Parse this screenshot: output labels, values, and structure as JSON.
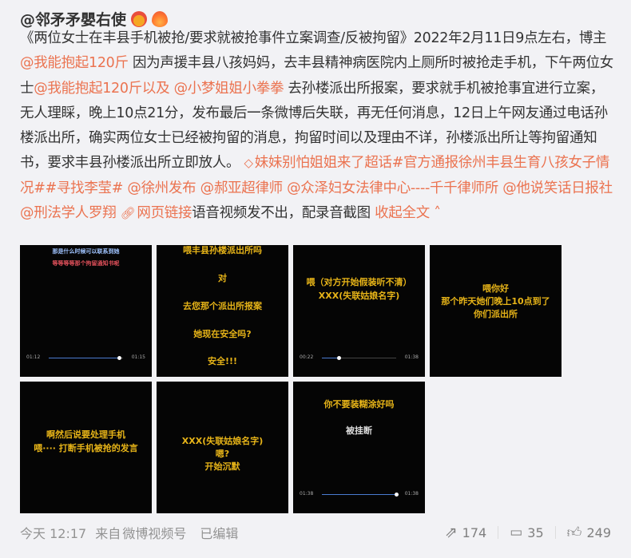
{
  "post": {
    "author": "@邻矛矛嬰右使",
    "body": {
      "t1": "《两位女士在丰县手机被抢/要求就被抢事件立案调查/反被拘留》2022年2月11日9点左右，博主",
      "m1": "@我能抱起120斤",
      "t2": " 因为声援丰县八孩妈妈，去丰县精神病医院内上厕所时被抢走手机，下午两位女士",
      "m2": "@我能抱起120斤以及",
      "t3": " ",
      "m3": "@小梦姐姐小拳拳",
      "t4": " 去孙楼派出所报案，要求就手机被抢事宜进行立案，无人理睬，晚上10点21分，发布最后一条微博后失联，再无任何消息，12日上午网友通过电话孙楼派出所，确实两位女士已经被拘留的消息，拘留时间以及理由不详，孙楼派出所让等拘留通知书，要求丰县孙楼派出所立即放人。",
      "supertopic": "妹妹别怕姐姐来了超话",
      "topic1": "#官方通报徐州丰县生育八孩女子情况#",
      "topic2": "#寻找李莹#",
      "m4": "@徐州发布",
      "m5": "@郝亚超律师",
      "m6": "@众泽妇女法律中心----千千律师所",
      "m7": "@他说笑话日报社",
      "m8": "@刑法学人罗翔",
      "weblink": "网页链接",
      "t5": "语音视频发不出，配录音截图",
      "collapse": "收起全文"
    },
    "images": [
      {
        "lines": [
          "那是什么时候可以联系到她",
          "等等等等那个拘留通知书呢"
        ],
        "time_start": "01:12",
        "time_end": "01:15",
        "progress": 0.95
      },
      {
        "lines": [
          "喂丰县孙楼派出所吗",
          "对",
          "去您那个派出所报案",
          "她现在安全吗?",
          "安全!!!"
        ]
      },
      {
        "lines": [
          "喂（对方开始假装听不清）",
          "XXX(失联姑娘名字)"
        ],
        "time_start": "00:22",
        "time_end": "01:38",
        "progress": 0.23
      },
      {
        "lines": [
          "喂你好",
          "那个昨天她们晚上10点到了",
          "你们派出所"
        ]
      },
      {
        "lines": [
          "啊然后说要处理手机",
          "喂····  打断手机被抢的发言"
        ]
      },
      {
        "lines": [
          "XXX(失联姑娘名字)",
          "嗯?",
          "开始沉默"
        ]
      },
      {
        "lines": [
          "你不要装糊涂好吗",
          "被挂断"
        ],
        "time_start": "01:38",
        "time_end": "01:38",
        "progress": 1.0
      }
    ],
    "footer": {
      "time": "今天 12:17",
      "source_prefix": "来自",
      "source": "微博视频号",
      "edited": "已编辑",
      "reposts": "174",
      "comments": "35",
      "likes": "249"
    }
  }
}
